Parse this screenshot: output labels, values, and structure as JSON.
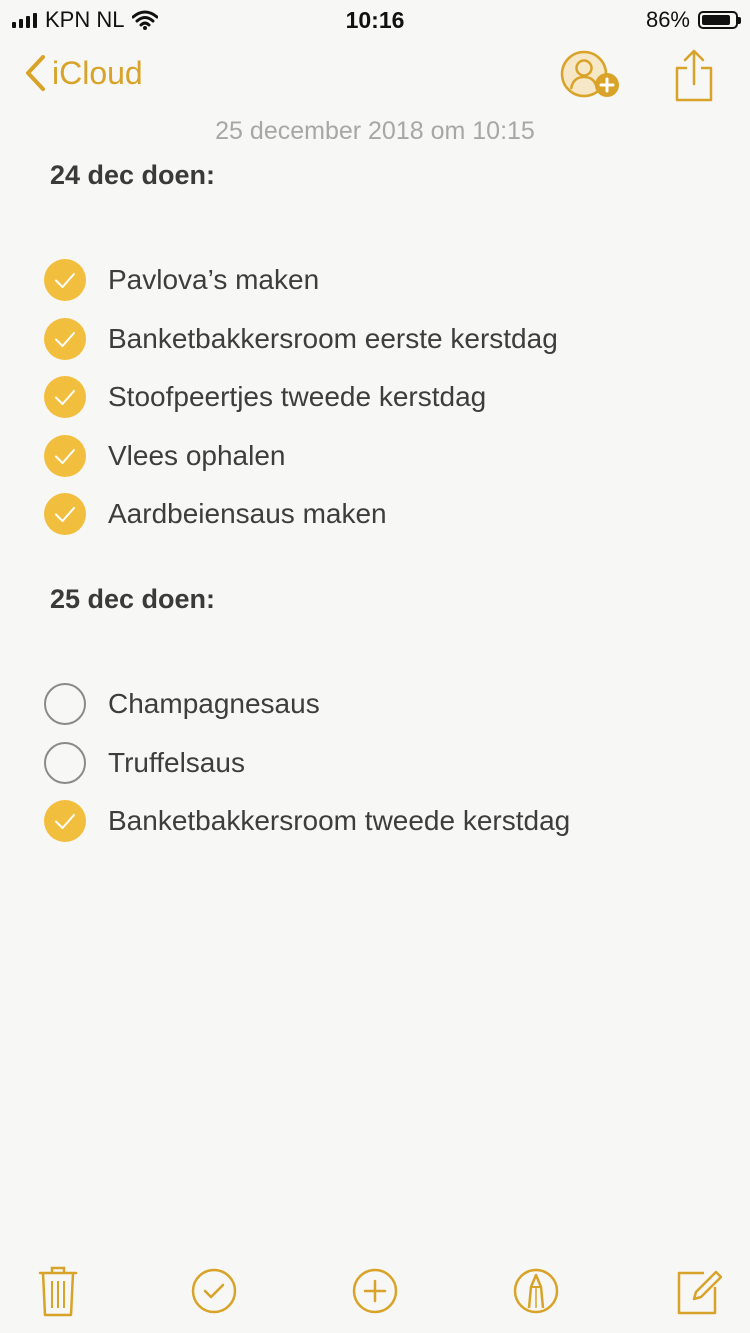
{
  "status_bar": {
    "carrier": "KPN NL",
    "time": "10:16",
    "battery": "86%",
    "battery_level": 0.86
  },
  "nav": {
    "back_label": "iCloud",
    "collaborate_icon": "person-add-icon",
    "share_icon": "share-icon"
  },
  "note": {
    "date": "25 december 2018 om 10:15",
    "sections": [
      {
        "title": "24 dec doen:",
        "items": [
          {
            "label": "Pavlova’s maken",
            "checked": true
          },
          {
            "label": "Banketbakkersroom eerste kerstdag",
            "checked": true
          },
          {
            "label": "Stoofpeertjes tweede kerstdag",
            "checked": true
          },
          {
            "label": "Vlees ophalen",
            "checked": true
          },
          {
            "label": "Aardbeiensaus maken",
            "checked": true
          }
        ]
      },
      {
        "title": "25 dec doen:",
        "items": [
          {
            "label": "Champagnesaus",
            "checked": false
          },
          {
            "label": "Truffelsaus",
            "checked": false
          },
          {
            "label": "Banketbakkersroom tweede kerstdag",
            "checked": true
          }
        ]
      }
    ]
  },
  "toolbar": {
    "icons": [
      "trash-icon",
      "checklist-icon",
      "add-icon",
      "markup-icon",
      "compose-icon"
    ]
  },
  "colors": {
    "accent": "#d8a328",
    "check_fill": "#f2be3e",
    "background": "#f7f7f5"
  }
}
